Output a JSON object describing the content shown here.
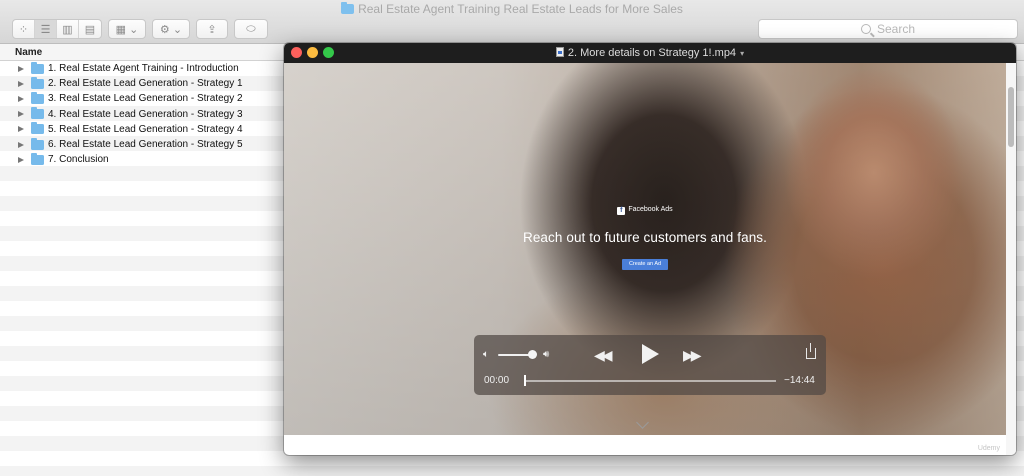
{
  "finder": {
    "title": "Real Estate Agent Training Real Estate Leads for More Sales",
    "search_placeholder": "Search",
    "column_name": "Name",
    "items": [
      {
        "label": "1. Real Estate Agent Training - Introduction"
      },
      {
        "label": "2. Real Estate Lead Generation - Strategy 1"
      },
      {
        "label": "3. Real Estate Lead Generation - Strategy 2"
      },
      {
        "label": "4. Real Estate Lead Generation - Strategy 3"
      },
      {
        "label": "5. Real Estate Lead Generation - Strategy 4"
      },
      {
        "label": "6. Real Estate Lead Generation - Strategy 5"
      },
      {
        "label": "7. Conclusion"
      }
    ],
    "icons": [
      "icon-view-icon",
      "list-view-icon",
      "column-view-icon",
      "cover-flow-icon",
      "group-icon",
      "gear-icon",
      "share-icon",
      "tag-icon",
      "folder-icon",
      "disclosure-triangle-icon"
    ]
  },
  "player": {
    "title": "2. More details on Strategy 1!.mp4",
    "video": {
      "brand": "Facebook Ads",
      "tagline": "Reach out to future customers and fans.",
      "cta": "Create an Ad"
    },
    "controls": {
      "current_time": "00:00",
      "remaining_time": "−14:44",
      "volume_level": 0.92,
      "progress": 0
    },
    "watermark": "Udemy"
  },
  "colors": {
    "close": "#fc605c",
    "minimize": "#fdbc40",
    "zoom": "#34c84a",
    "folder": "#76baeb",
    "cta": "#4a7fd9"
  }
}
